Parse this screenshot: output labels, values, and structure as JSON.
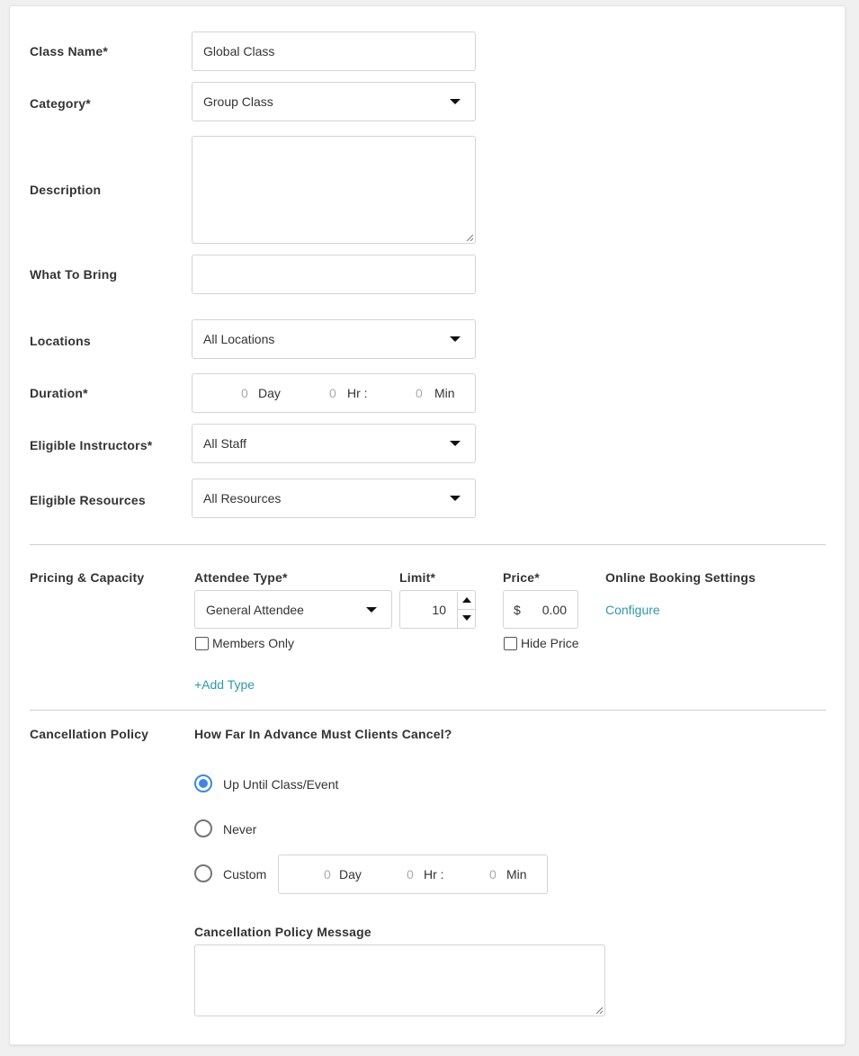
{
  "form": {
    "class_name": {
      "label": "Class Name*",
      "value": "Global Class"
    },
    "category": {
      "label": "Category*",
      "value": "Group Class"
    },
    "description": {
      "label": "Description",
      "value": ""
    },
    "what_to_bring": {
      "label": "What To Bring",
      "value": ""
    },
    "locations": {
      "label": "Locations",
      "value": "All Locations"
    },
    "duration": {
      "label": "Duration*",
      "day_value": "0",
      "day_unit": "Day",
      "hr_value": "0",
      "hr_unit": "Hr :",
      "min_value": "0",
      "min_unit": "Min"
    },
    "eligible_instructors": {
      "label": "Eligible Instructors*",
      "value": "All Staff"
    },
    "eligible_resources": {
      "label": "Eligible Resources",
      "value": "All Resources"
    }
  },
  "pricing": {
    "section_label": "Pricing & Capacity",
    "attendee_type_header": "Attendee Type*",
    "limit_header": "Limit*",
    "price_header": "Price*",
    "online_booking_header": "Online Booking Settings",
    "attendee_type_value": "General Attendee",
    "limit_value": "10",
    "currency_symbol": "$",
    "price_value": "0.00",
    "configure_link": "Configure",
    "members_only_label": "Members Only",
    "hide_price_label": "Hide Price",
    "add_type_link": "+Add Type"
  },
  "cancellation": {
    "section_label": "Cancellation Policy",
    "question": "How Far In Advance Must Clients Cancel?",
    "options": {
      "up_until": "Up Until Class/Event",
      "never": "Never",
      "custom": "Custom"
    },
    "selected": "up_until",
    "custom_duration": {
      "day_value": "0",
      "day_unit": "Day",
      "hr_value": "0",
      "hr_unit": "Hr :",
      "min_value": "0",
      "min_unit": "Min"
    },
    "message_label": "Cancellation Policy Message",
    "message_value": ""
  },
  "colors": {
    "accent_link": "#2a9aa8",
    "radio_selected": "#3d86e8",
    "border": "#d4d4d4"
  }
}
